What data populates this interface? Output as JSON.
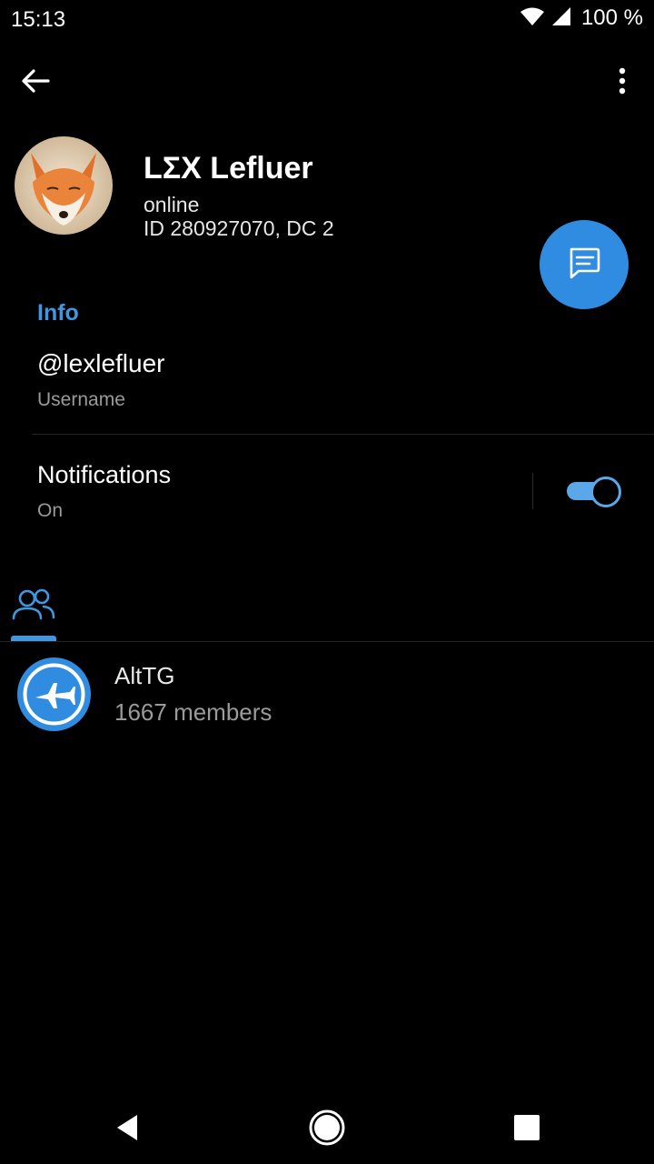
{
  "status_bar": {
    "time": "15:13",
    "battery": "100 %",
    "icons": [
      "wifi-icon",
      "signal-icon"
    ]
  },
  "toolbar": {
    "back_icon": "back-arrow-icon",
    "menu_icon": "more-vert-icon"
  },
  "profile": {
    "name": "LΣX Lefluer",
    "status": "online",
    "id_line": "ID 280927070, DC 2",
    "avatar_icon": "fox-avatar"
  },
  "fab": {
    "icon": "message-icon",
    "color": "#2f8ce0"
  },
  "info": {
    "section_title": "Info",
    "username_value": "@lexlefluer",
    "username_caption": "Username",
    "notifications_title": "Notifications",
    "notifications_value": "On",
    "notifications_enabled": true
  },
  "tabs": {
    "active_icon": "groups-icon"
  },
  "groups": [
    {
      "name": "AltTG",
      "members": "1667 members",
      "icon": "jet-plane-icon"
    }
  ],
  "colors": {
    "accent": "#3e97e0",
    "background": "#000000"
  }
}
